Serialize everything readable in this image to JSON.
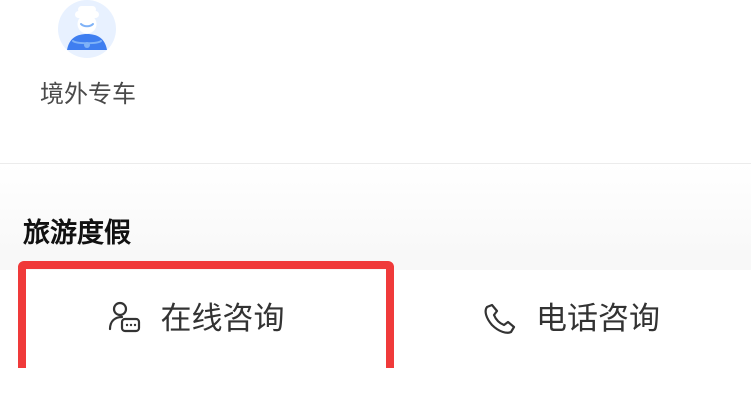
{
  "top_services": {
    "item_1": {
      "label": "境外专车",
      "icon": "chauffeur-icon"
    }
  },
  "section": {
    "title": "旅游度假"
  },
  "actions": {
    "online_consult": {
      "label": "在线咨询",
      "icon": "chat-agent-icon",
      "highlighted": true
    },
    "phone_consult": {
      "label": "电话咨询",
      "icon": "phone-icon"
    }
  },
  "colors": {
    "highlight": "#f03a3a",
    "service_icon_blue": "#7fb2f7",
    "service_icon_dark_blue": "#3f7ef0",
    "text_primary": "#333333",
    "title_text": "#111111"
  }
}
